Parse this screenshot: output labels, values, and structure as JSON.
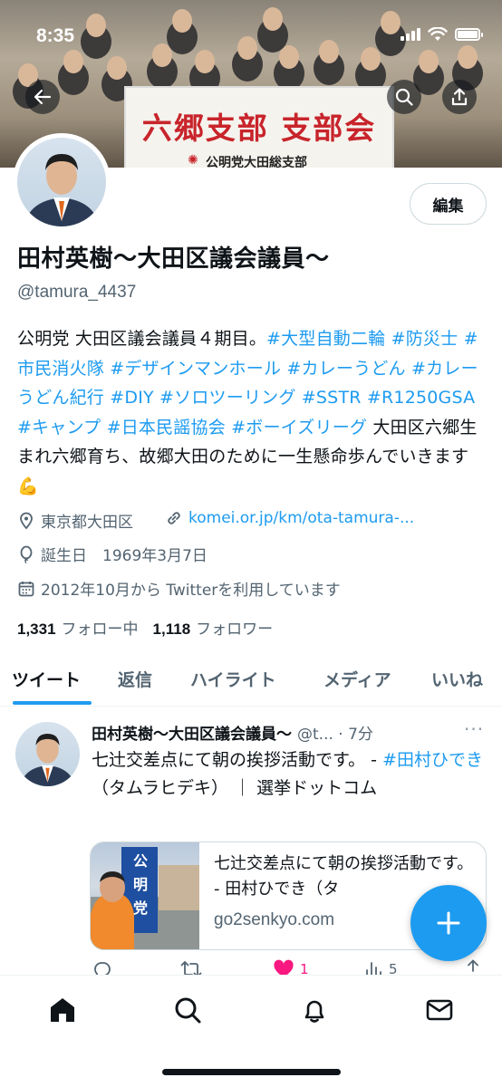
{
  "status_bar": {
    "time": "8:35"
  },
  "banner": {
    "sign_title": "六郷支部 支部会",
    "sign_subtitle": "公明党大田総支部"
  },
  "header": {
    "back_icon": "arrow-left-icon",
    "search_icon": "search-icon",
    "share_icon": "share-icon"
  },
  "profile": {
    "edit_label": "編集",
    "name": "田村英樹〜大田区議会議員〜",
    "handle": "@tamura_4437",
    "bio": [
      {
        "text": "公明党 大田区議会議員４期目。"
      },
      {
        "text": "#大型自動二輪 #防災士 #市民消火隊 #デザインマンホール #カレーうどん #カレーうどん紀行 #DIY #ソロツーリング #SSTR #R1250GSA #キャンプ #日本民謡協会 #ボーイズリーグ",
        "tag": true
      },
      {
        "text": " 大田区六郷生まれ六郷育ち、故郷大田のために一生懸命歩んでいきます💪"
      }
    ],
    "location": "東京都大田区",
    "website": "komei.or.jp/km/ota-tamura-...",
    "birthday": "誕生日　1969年3月7日",
    "joined": "2012年10月から Twitterを利用しています",
    "following_count": "1,331",
    "following_label": "フォロー中",
    "followers_count": "1,118",
    "followers_label": "フォロワー"
  },
  "tabs": [
    {
      "label": "ツイート",
      "active": true
    },
    {
      "label": "返信"
    },
    {
      "label": "ハイライト"
    },
    {
      "label": "メディア"
    },
    {
      "label": "いいね"
    }
  ],
  "tweet": {
    "author": "田村英樹〜大田区議会議員〜",
    "meta": "@t... · 7分",
    "text_plain": "七辻交差点にて朝の挨拶活動です。 - ",
    "text_tag": "#田村ひでき",
    "text_rest": "（タムラヒデキ） ｜ 選挙ドットコム",
    "card_title": "七辻交差点にて朝の挨拶活動です。 - 田村ひでき（タ",
    "card_domain": "go2senkyo.com",
    "card_flag_text": "公明党",
    "like_count": "1",
    "views_count": "5"
  },
  "nav": {
    "home_icon": "home-icon",
    "search_icon": "search-icon",
    "notifications_icon": "bell-icon",
    "messages_icon": "mail-icon"
  },
  "colors": {
    "accent": "#1d9bf0",
    "text": "#0f1419",
    "secondary": "#536471",
    "like": "#f91880"
  }
}
